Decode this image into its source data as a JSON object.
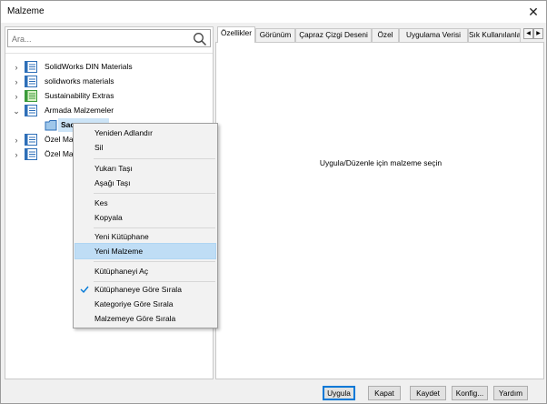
{
  "window": {
    "title": "Malzeme",
    "close_glyph": "✕"
  },
  "search": {
    "placeholder": "Ara...",
    "icon": "search-icon"
  },
  "tree": [
    {
      "label": "SolidWorks DIN Materials",
      "expanded": false,
      "icon_color": "#2e6fb8"
    },
    {
      "label": "solidworks materials",
      "expanded": false,
      "icon_color": "#2e6fb8"
    },
    {
      "label": "Sustainability Extras",
      "expanded": false,
      "icon_color": "#3a9a3a"
    },
    {
      "label": "Armada Malzemeler",
      "expanded": true,
      "icon_color": "#2e6fb8"
    },
    {
      "label": "Sac",
      "selected": true,
      "icon_color": "#2e6fb8"
    },
    {
      "label": "Özel Mal",
      "expanded": false,
      "icon_color": "#2e6fb8"
    },
    {
      "label": "Özel Mal",
      "expanded": false,
      "icon_color": "#2e6fb8"
    }
  ],
  "tabs": [
    {
      "label": "Özellikler",
      "active": true
    },
    {
      "label": "Görünüm"
    },
    {
      "label": "Çapraz Çizgi Deseni"
    },
    {
      "label": "Özel"
    },
    {
      "label": "Uygulama Verisi"
    },
    {
      "label": "Sık Kullanılanla"
    }
  ],
  "tab_scroll": {
    "left": "◀",
    "right": "▶"
  },
  "content": {
    "hint": "Uygula/Düzenle için malzeme seçin"
  },
  "buttons": {
    "apply": "Uygula",
    "close": "Kapat",
    "save": "Kaydet",
    "config": "Konfig...",
    "help": "Yardım"
  },
  "context_menu": {
    "rename": "Yeniden Adlandır",
    "delete": "Sil",
    "move_up": "Yukarı Taşı",
    "move_down": "Aşağı Taşı",
    "cut": "Kes",
    "copy": "Kopyala",
    "new_library": "Yeni Kütüphane",
    "new_material": "Yeni Malzeme",
    "open_library": "Kütüphaneyi Aç",
    "sort_library": "Kütüphaneye Göre Sırala",
    "sort_category": "Kategoriye Göre Sırala",
    "sort_material": "Malzemeye Göre Sırala",
    "highlighted": "new_material",
    "checked": "sort_library"
  },
  "colors": {
    "accent": "#0078d7",
    "highlight": "#bfddf5",
    "selection": "#cce4f7"
  }
}
